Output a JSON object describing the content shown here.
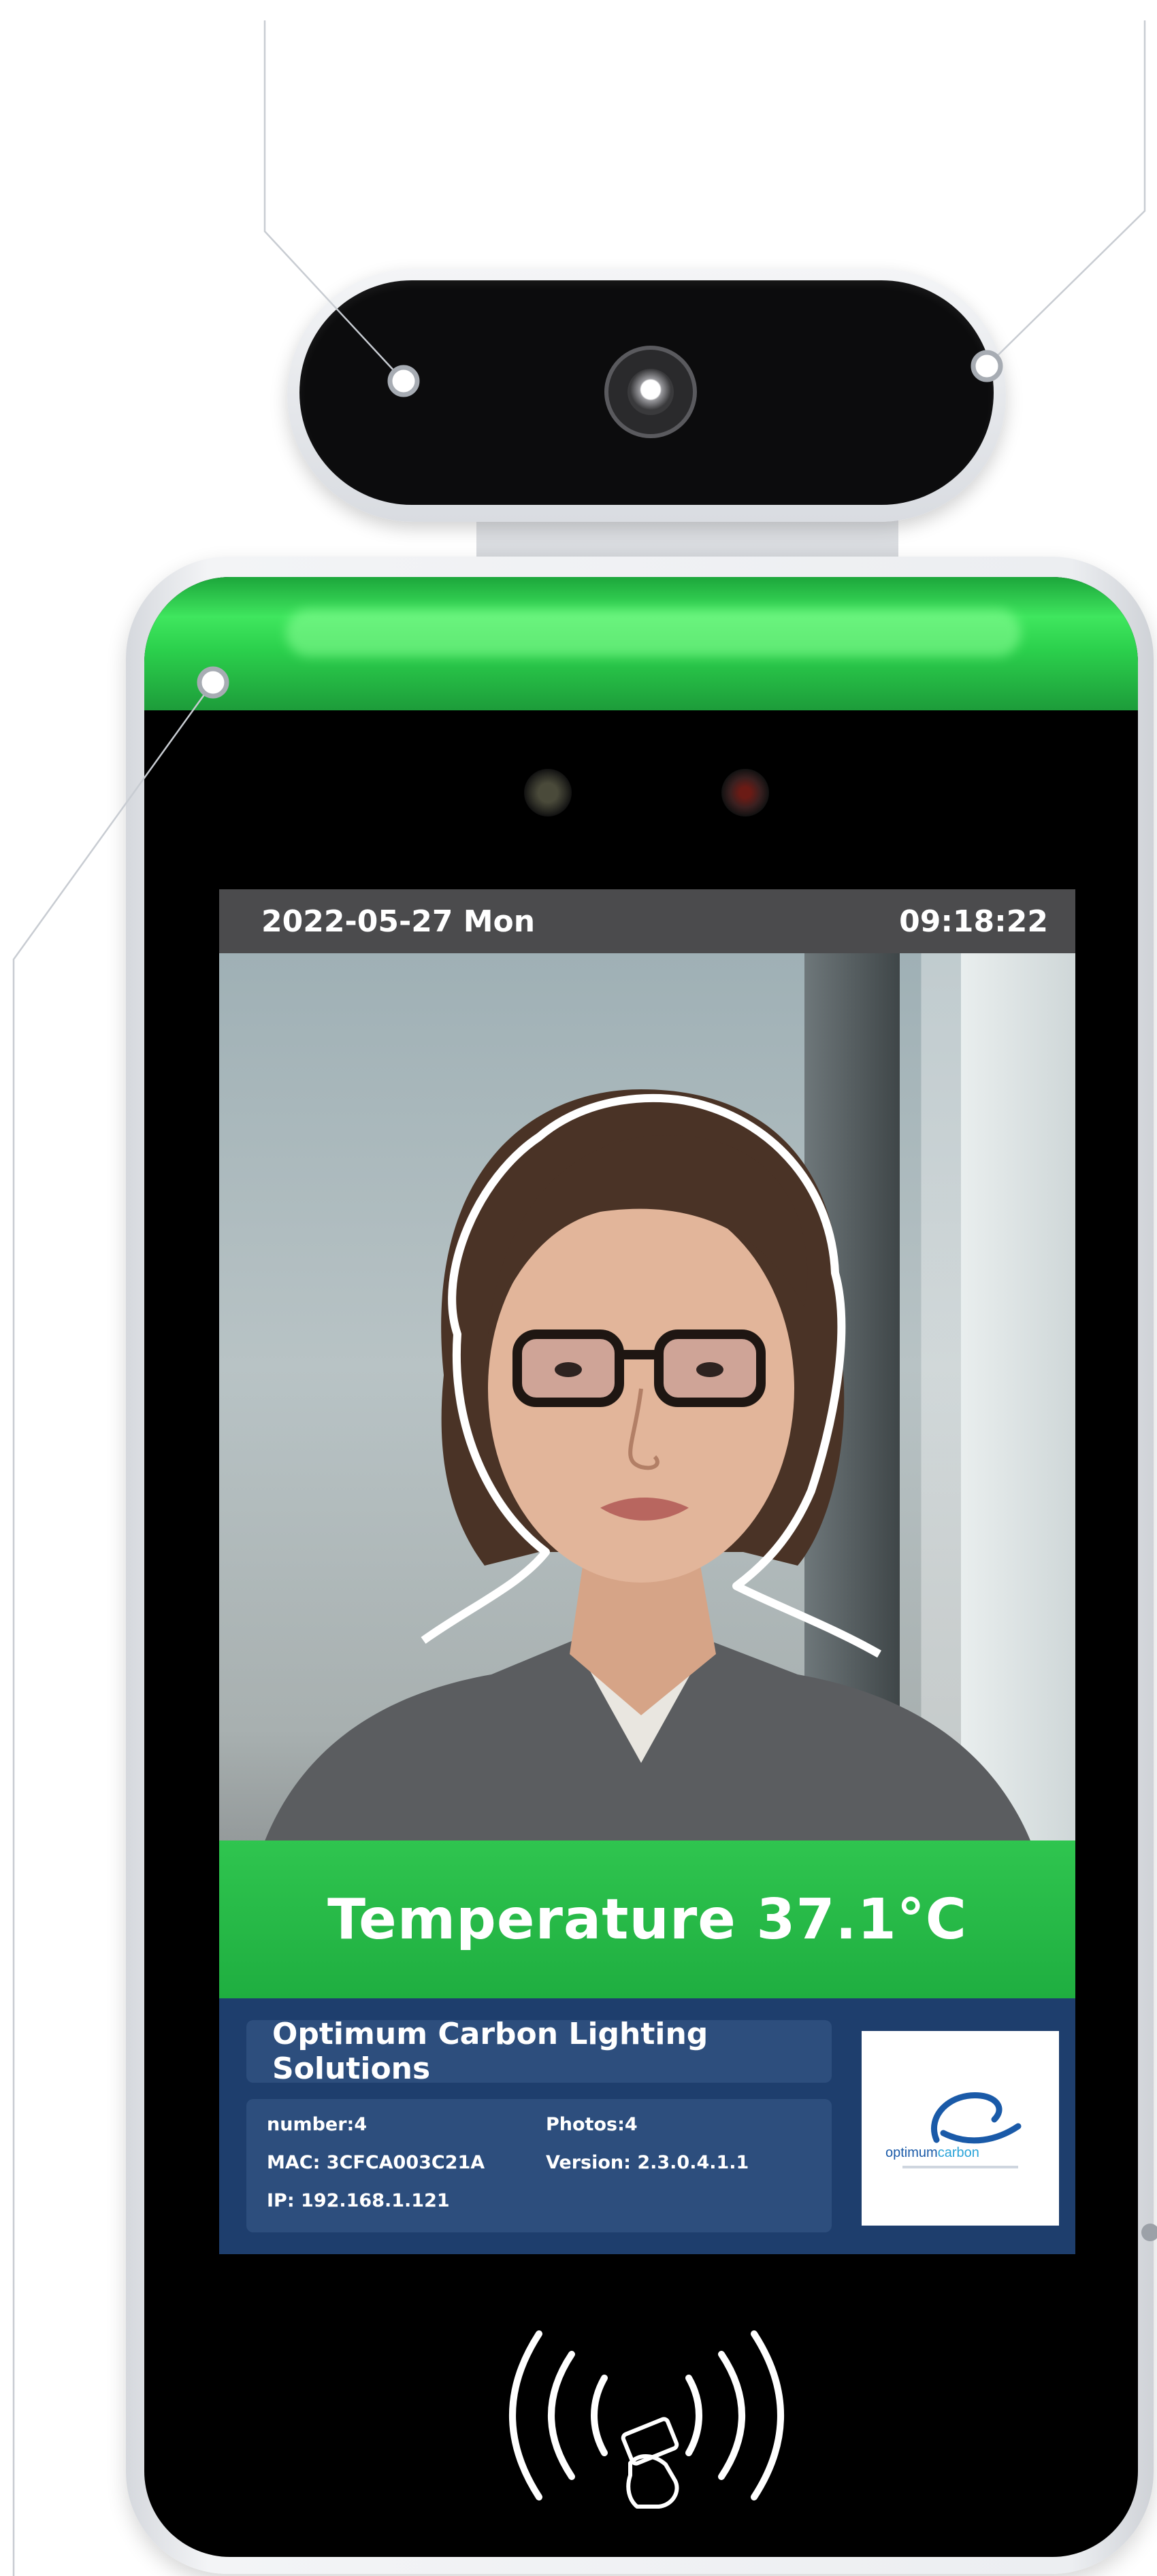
{
  "screen": {
    "date": "2022-05-27 Mon",
    "time": "09:18:22",
    "temperature_label": "Temperature 37.1°C",
    "company_name": "Optimum Carbon Lighting Solutions",
    "details": {
      "number": "number:4",
      "photos": "Photos:4",
      "mac": "MAC: 3CFCA003C21A",
      "version": "Version: 2.3.0.4.1.1",
      "ip": "IP: 192.168.1.121"
    },
    "logo": {
      "text_part1": "optimum",
      "text_part2": "carbon"
    }
  },
  "colors": {
    "led_green": "#2bd04c",
    "temperature_band": "#1fae40",
    "info_panel": "#1e3e6d",
    "logo_blue": "#1a5aa8"
  },
  "icons": [
    "camera-lens-icon",
    "nfc-card-icon",
    "callout-dot-icon"
  ]
}
